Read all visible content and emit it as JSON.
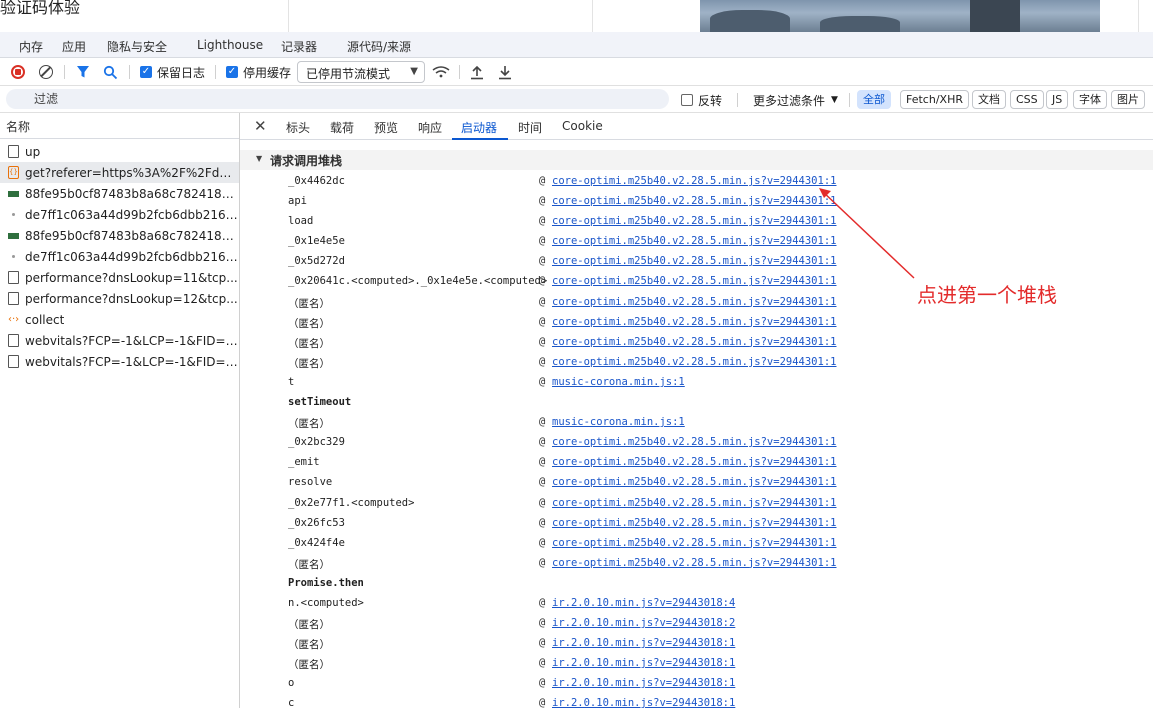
{
  "page": {
    "title": "验证码体验"
  },
  "devtools_tabs": [
    "内存",
    "应用",
    "隐私与安全",
    "Lighthouse",
    "记录器",
    "源代码/来源"
  ],
  "toolbar": {
    "preserve_log_label": "保留日志",
    "disable_cache_label": "停用缓存",
    "throttle_value": "已停用节流模式"
  },
  "filter": {
    "placeholder": "过滤",
    "invert_label": "反转",
    "more_filters_label": "更多过滤条件",
    "type_chips": [
      "全部",
      "Fetch/XHR",
      "文档",
      "CSS",
      "JS",
      "字体",
      "图片"
    ]
  },
  "request_list": {
    "header": "名称",
    "items": [
      {
        "name": "up",
        "icon": "document-icon"
      },
      {
        "name": "get?referer=https%3A%2F%2Fdun...",
        "icon": "xhr-icon"
      },
      {
        "name": "88fe95b0cf87483b8a68c7824187b...",
        "icon": "image-icon"
      },
      {
        "name": "de7ff1c063a44d99b2fcb6dbb216b...",
        "icon": "dot-icon"
      },
      {
        "name": "88fe95b0cf87483b8a68c7824187b...",
        "icon": "image-icon"
      },
      {
        "name": "de7ff1c063a44d99b2fcb6dbb216b...",
        "icon": "dot-icon"
      },
      {
        "name": "performance?dnsLookup=11&tcp...",
        "icon": "document-icon"
      },
      {
        "name": "performance?dnsLookup=12&tcp...",
        "icon": "document-icon"
      },
      {
        "name": "collect",
        "icon": "script-icon"
      },
      {
        "name": "webvitals?FCP=-1&LCP=-1&FID=-...",
        "icon": "document-icon"
      },
      {
        "name": "webvitals?FCP=-1&LCP=-1&FID=-...",
        "icon": "document-icon"
      }
    ]
  },
  "detail_tabs": {
    "close": "✕",
    "tabs": [
      "标头",
      "载荷",
      "预览",
      "响应",
      "启动器",
      "时间",
      "Cookie"
    ],
    "active": "启动器"
  },
  "initiator": {
    "section_title": "请求调用堆栈",
    "frames": [
      {
        "fn": "_0x4462dc",
        "src": "core-optimi.m25b40.v2.28.5.min.js?v=2944301:1"
      },
      {
        "fn": "api",
        "src": "core-optimi.m25b40.v2.28.5.min.js?v=2944301:1"
      },
      {
        "fn": "load",
        "src": "core-optimi.m25b40.v2.28.5.min.js?v=2944301:1"
      },
      {
        "fn": "_0x1e4e5e",
        "src": "core-optimi.m25b40.v2.28.5.min.js?v=2944301:1"
      },
      {
        "fn": "_0x5d272d",
        "src": "core-optimi.m25b40.v2.28.5.min.js?v=2944301:1"
      },
      {
        "fn": "_0x20641c.<computed>._0x1e4e5e.<computed>",
        "src": "core-optimi.m25b40.v2.28.5.min.js?v=2944301:1"
      },
      {
        "fn": "（匿名）",
        "src": "core-optimi.m25b40.v2.28.5.min.js?v=2944301:1"
      },
      {
        "fn": "（匿名）",
        "src": "core-optimi.m25b40.v2.28.5.min.js?v=2944301:1"
      },
      {
        "fn": "（匿名）",
        "src": "core-optimi.m25b40.v2.28.5.min.js?v=2944301:1"
      },
      {
        "fn": "（匿名）",
        "src": "core-optimi.m25b40.v2.28.5.min.js?v=2944301:1"
      },
      {
        "fn": "t",
        "src": "music-corona.min.js:1"
      },
      {
        "fn": "setTimeout",
        "src": "",
        "async": true
      },
      {
        "fn": "（匿名）",
        "src": "music-corona.min.js:1"
      },
      {
        "fn": "_0x2bc329",
        "src": "core-optimi.m25b40.v2.28.5.min.js?v=2944301:1"
      },
      {
        "fn": "_emit",
        "src": "core-optimi.m25b40.v2.28.5.min.js?v=2944301:1"
      },
      {
        "fn": "resolve",
        "src": "core-optimi.m25b40.v2.28.5.min.js?v=2944301:1"
      },
      {
        "fn": "_0x2e77f1.<computed>",
        "src": "core-optimi.m25b40.v2.28.5.min.js?v=2944301:1"
      },
      {
        "fn": "_0x26fc53",
        "src": "core-optimi.m25b40.v2.28.5.min.js?v=2944301:1"
      },
      {
        "fn": "_0x424f4e",
        "src": "core-optimi.m25b40.v2.28.5.min.js?v=2944301:1"
      },
      {
        "fn": "（匿名）",
        "src": "core-optimi.m25b40.v2.28.5.min.js?v=2944301:1"
      },
      {
        "fn": "Promise.then",
        "src": "",
        "async": true
      },
      {
        "fn": "n.<computed>",
        "src": "ir.2.0.10.min.js?v=29443018:4"
      },
      {
        "fn": "（匿名）",
        "src": "ir.2.0.10.min.js?v=29443018:2"
      },
      {
        "fn": "（匿名）",
        "src": "ir.2.0.10.min.js?v=29443018:1"
      },
      {
        "fn": "（匿名）",
        "src": "ir.2.0.10.min.js?v=29443018:1"
      },
      {
        "fn": "o",
        "src": "ir.2.0.10.min.js?v=29443018:1"
      },
      {
        "fn": "c",
        "src": "ir.2.0.10.min.js?v=29443018:1"
      }
    ]
  },
  "annotation": {
    "text": "点进第一个堆栈",
    "color": "#e32b2b"
  }
}
